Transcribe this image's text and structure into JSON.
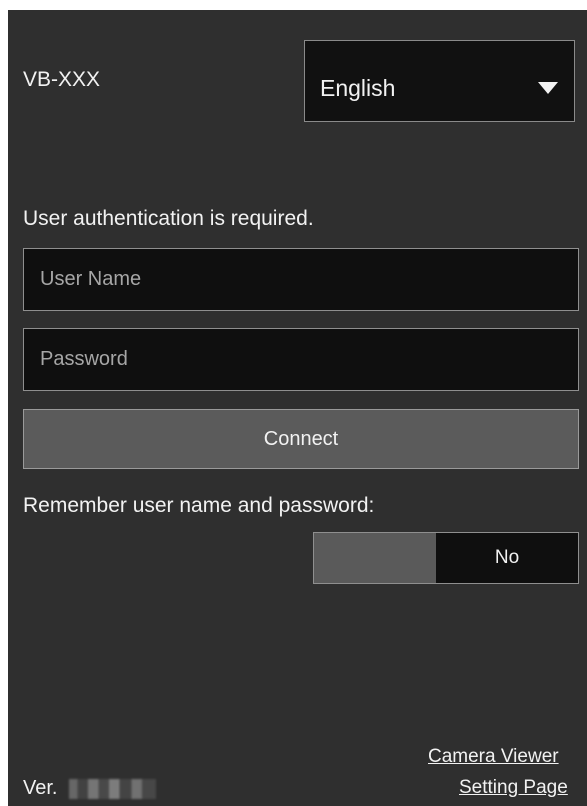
{
  "header": {
    "device_name": "VB-XXX",
    "language": {
      "selected": "English",
      "icon": "chevron-down-icon"
    }
  },
  "auth": {
    "message": "User authentication is required.",
    "username": {
      "value": "",
      "placeholder": "User Name"
    },
    "password": {
      "value": "",
      "placeholder": "Password"
    },
    "connect_label": "Connect"
  },
  "remember": {
    "label": "Remember user name and password:",
    "toggle_value": "No"
  },
  "footer": {
    "version_label": "Ver.",
    "links": {
      "camera_viewer": "Camera Viewer",
      "setting_page": "Setting Page"
    }
  },
  "colors": {
    "background": "#2f2f2f",
    "input_background": "#0f0f0f",
    "button_background": "#5b5b5b",
    "text": "#f2f2f2",
    "border": "#8f8f8f"
  }
}
